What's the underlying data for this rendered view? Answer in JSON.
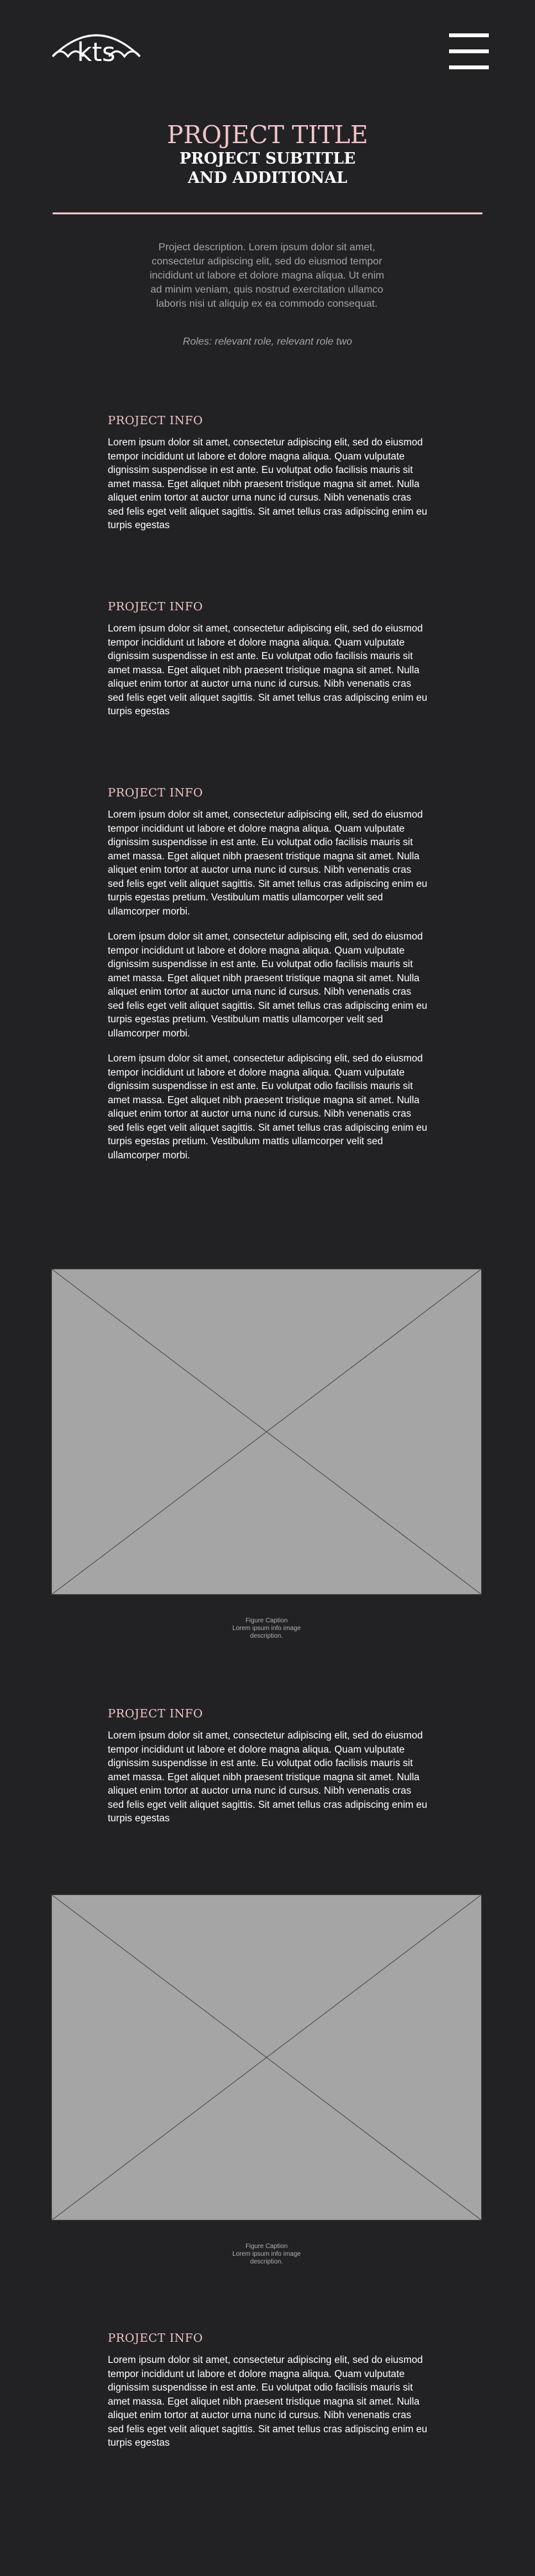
{
  "header": {
    "logo_text": "kts",
    "logo_icon": "umbrella-logo-icon",
    "menu_icon": "hamburger-menu-icon"
  },
  "project": {
    "title": "PROJECT TITLE",
    "subtitle_line1": "PROJECT SUBTITLE",
    "subtitle_line2": "AND ADDITIONAL",
    "description": "Project description. Lorem ipsum dolor sit amet, consectetur adipiscing elit, sed do eiusmod tempor incididunt ut labore et dolore magna aliqua. Ut enim ad minim veniam, quis nostrud exercitation ullamco laboris nisi ut aliquip ex ea commodo consequat.",
    "roles": "Roles: relevant role, relevant role two"
  },
  "sections": [
    {
      "heading": "PROJECT INFO",
      "paragraphs": [
        "Lorem ipsum dolor sit amet, consectetur adipiscing elit, sed do eiusmod tempor incididunt ut labore et dolore magna aliqua. Quam vulputate dignissim suspendisse in est ante. Eu volutpat odio facilisis mauris sit amet massa. Eget aliquet nibh praesent tristique magna sit amet. Nulla aliquet enim tortor at auctor urna nunc id cursus. Nibh venenatis cras sed felis eget velit aliquet sagittis. Sit amet tellus cras adipiscing enim eu turpis egestas"
      ]
    },
    {
      "heading": "PROJECT INFO",
      "paragraphs": [
        "Lorem ipsum dolor sit amet, consectetur adipiscing elit, sed do eiusmod tempor incididunt ut labore et dolore magna aliqua. Quam vulputate dignissim suspendisse in est ante. Eu volutpat odio facilisis mauris sit amet massa. Eget aliquet nibh praesent tristique magna sit amet. Nulla aliquet enim tortor at auctor urna nunc id cursus. Nibh venenatis cras sed felis eget velit aliquet sagittis. Sit amet tellus cras adipiscing enim eu turpis egestas"
      ]
    },
    {
      "heading": "PROJECT INFO",
      "paragraphs": [
        "Lorem ipsum dolor sit amet, consectetur adipiscing elit, sed do eiusmod tempor incididunt ut labore et dolore magna aliqua. Quam vulputate dignissim suspendisse in est ante. Eu volutpat odio facilisis mauris sit amet massa. Eget aliquet nibh praesent tristique magna sit amet. Nulla aliquet enim tortor at auctor urna nunc id cursus. Nibh venenatis cras sed felis eget velit aliquet sagittis. Sit amet tellus cras adipiscing enim eu turpis egestas pretium. Vestibulum mattis ullamcorper velit sed ullamcorper morbi.",
        "Lorem ipsum dolor sit amet, consectetur adipiscing elit, sed do eiusmod tempor incididunt ut labore et dolore magna aliqua. Quam vulputate dignissim suspendisse in est ante. Eu volutpat odio facilisis mauris sit amet massa. Eget aliquet nibh praesent tristique magna sit amet. Nulla aliquet enim tortor at auctor urna nunc id cursus. Nibh venenatis cras sed felis eget velit aliquet sagittis. Sit amet tellus cras adipiscing enim eu turpis egestas pretium. Vestibulum mattis ullamcorper velit sed ullamcorper morbi.",
        "Lorem ipsum dolor sit amet, consectetur adipiscing elit, sed do eiusmod tempor incididunt ut labore et dolore magna aliqua. Quam vulputate dignissim suspendisse in est ante. Eu volutpat odio facilisis mauris sit amet massa. Eget aliquet nibh praesent tristique magna sit amet. Nulla aliquet enim tortor at auctor urna nunc id cursus. Nibh venenatis cras sed felis eget velit aliquet sagittis. Sit amet tellus cras adipiscing enim eu turpis egestas pretium. Vestibulum mattis ullamcorper velit sed ullamcorper morbi."
      ]
    },
    {
      "heading": "PROJECT INFO",
      "paragraphs": [
        "Lorem ipsum dolor sit amet, consectetur adipiscing elit, sed do eiusmod tempor incididunt ut labore et dolore magna aliqua. Quam vulputate dignissim suspendisse in est ante. Eu volutpat odio facilisis mauris sit amet massa. Eget aliquet nibh praesent tristique magna sit amet. Nulla aliquet enim tortor at auctor urna nunc id cursus. Nibh venenatis cras sed felis eget velit aliquet sagittis. Sit amet tellus cras adipiscing enim eu turpis egestas"
      ]
    },
    {
      "heading": "PROJECT INFO",
      "paragraphs": [
        "Lorem ipsum dolor sit amet, consectetur adipiscing elit, sed do eiusmod tempor incididunt ut labore et dolore magna aliqua. Quam vulputate dignissim suspendisse in est ante. Eu volutpat odio facilisis mauris sit amet massa. Eget aliquet nibh praesent tristique magna sit amet. Nulla aliquet enim tortor at auctor urna nunc id cursus. Nibh venenatis cras sed felis eget velit aliquet sagittis. Sit amet tellus cras adipiscing enim eu turpis egestas"
      ]
    }
  ],
  "figures": [
    {
      "caption_line1": "Figure Caption",
      "caption_line2": "Lorem ipsum info image",
      "caption_line3": "description."
    },
    {
      "caption_line1": "Figure Caption",
      "caption_line2": "Lorem ipsum info image",
      "caption_line3": "description."
    }
  ],
  "colors": {
    "background": "#222224",
    "accent": "#f0c4c8",
    "placeholder": "#a5a5a5"
  }
}
